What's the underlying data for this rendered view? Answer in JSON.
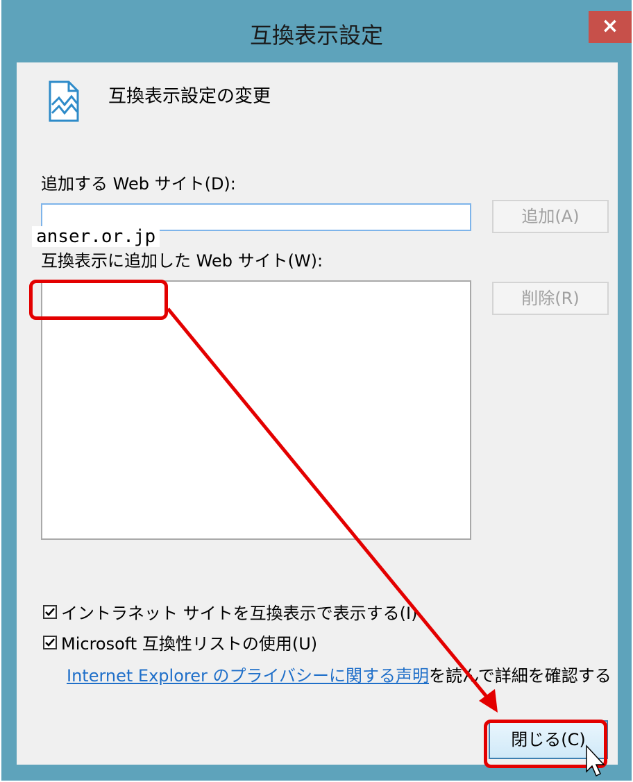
{
  "window": {
    "title": "互換表示設定",
    "close_glyph": "×"
  },
  "header": {
    "text": "互換表示設定の変更",
    "icon": "page-image-icon"
  },
  "add_site": {
    "label": "追加する Web サイト(D):",
    "input_value": "",
    "button_label": "追加(A)"
  },
  "sites_list": {
    "label": "互換表示に追加した Web サイト(W):",
    "items": [
      "anser.or.jp"
    ],
    "remove_button_label": "削除(R)"
  },
  "options": {
    "intranet_label": "イントラネット サイトを互換表示で表示する(I)",
    "intranet_checked": true,
    "ms_list_label": "Microsoft 互換性リストの使用(U)",
    "ms_list_checked": true
  },
  "privacy": {
    "link_text": "Internet Explorer のプライバシーに関する声明",
    "suffix_text": "を読んで詳細を確認する"
  },
  "footer": {
    "close_button_label": "閉じる(C)"
  },
  "colors": {
    "titlebar": "#5ea3bb",
    "close": "#c7504a",
    "annotation": "#e30000",
    "link": "#1f6fc9"
  }
}
